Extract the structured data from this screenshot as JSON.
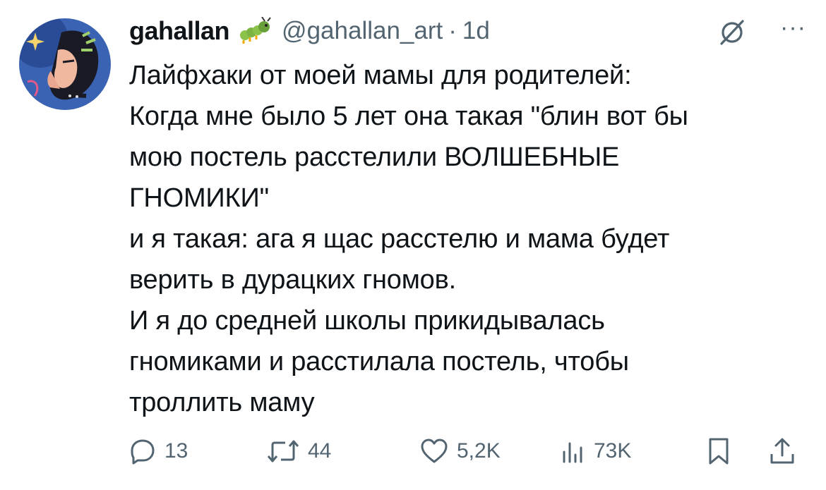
{
  "tweet": {
    "author": {
      "name": "gahallan",
      "handle": "@gahallan_art",
      "separator": "·",
      "time": "1d"
    },
    "body_lines": [
      "Лайфхаки от моей мамы для родителей:",
      "Когда мне было 5 лет она такая \"блин вот бы",
      "мою постель расстелили ВОЛШЕБНЫЕ",
      "ГНОМИКИ\"",
      "и я такая: ага я щас расстелю и мама будет",
      "верить в дурацких гномов.",
      "И я до средней школы прикидывалась",
      "гномиками и расстилала постель, чтобы",
      "троллить маму"
    ],
    "more_label": "···",
    "stats": {
      "replies": "13",
      "reposts": "44",
      "likes": "5,2K",
      "views": "73K"
    }
  },
  "icons": {
    "badge": "caterpillar-emoji",
    "grok": "grok-slash-icon",
    "reply": "reply-icon",
    "repost": "repost-icon",
    "like": "heart-icon",
    "views": "views-bar-chart-icon",
    "bookmark": "bookmark-icon",
    "share": "share-icon"
  },
  "colors": {
    "text": "#0f1419",
    "secondary": "#536471",
    "avatar_bg": "#2e57a8"
  }
}
